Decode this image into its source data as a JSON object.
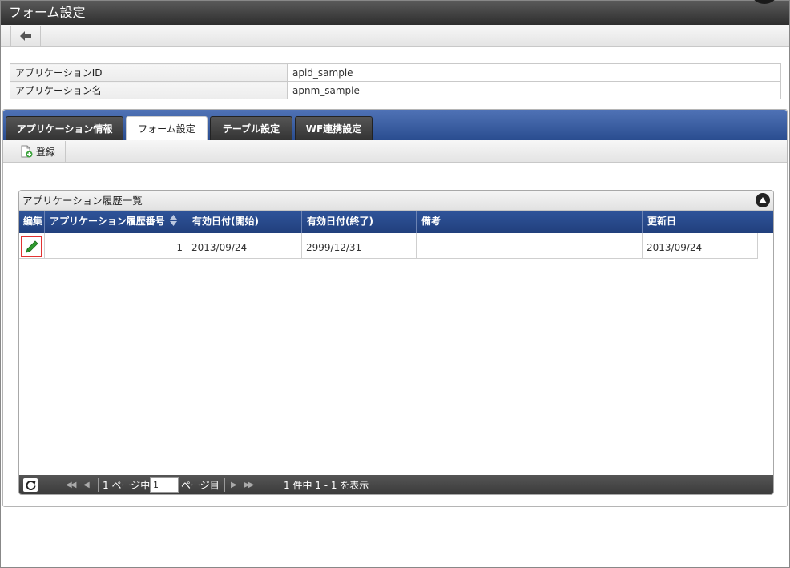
{
  "window": {
    "title": "フォーム設定"
  },
  "info": {
    "rows": [
      {
        "label": "アプリケーションID",
        "value": "apid_sample"
      },
      {
        "label": "アプリケーション名",
        "value": "apnm_sample"
      }
    ]
  },
  "tabs": [
    {
      "label": "アプリケーション情報",
      "active": false
    },
    {
      "label": "フォーム設定",
      "active": true
    },
    {
      "label": "テーブル設定",
      "active": false
    },
    {
      "label": "WF連携設定",
      "active": false
    }
  ],
  "toolbar": {
    "register_label": "登録"
  },
  "grid": {
    "caption": "アプリケーション履歴一覧",
    "columns": [
      "編集",
      "アプリケーション履歴番号",
      "有効日付(開始)",
      "有効日付(終了)",
      "備考",
      "更新日"
    ],
    "rows": [
      {
        "number": "1",
        "start": "2013/09/24",
        "end": "2999/12/31",
        "note": "",
        "updated": "2013/09/24"
      }
    ]
  },
  "pager": {
    "prefix": "1 ページ中",
    "current_page": "1",
    "suffix": "ページ目",
    "summary": "1 件中 1 - 1 を表示"
  },
  "colors": {
    "titlebar": "#3a3a3a",
    "tabbar": "#2f549a",
    "edit_highlight": "#e23232",
    "pencil": "#2e9a2e"
  }
}
